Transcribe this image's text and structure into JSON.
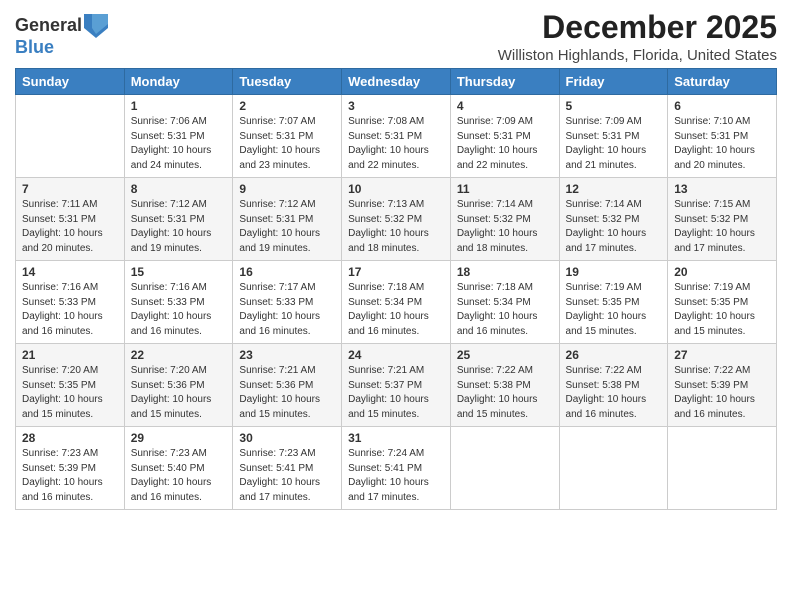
{
  "logo": {
    "general": "General",
    "blue": "Blue"
  },
  "title": "December 2025",
  "location": "Williston Highlands, Florida, United States",
  "weekdays": [
    "Sunday",
    "Monday",
    "Tuesday",
    "Wednesday",
    "Thursday",
    "Friday",
    "Saturday"
  ],
  "weeks": [
    [
      {
        "day": "",
        "info": ""
      },
      {
        "day": "1",
        "info": "Sunrise: 7:06 AM\nSunset: 5:31 PM\nDaylight: 10 hours\nand 24 minutes."
      },
      {
        "day": "2",
        "info": "Sunrise: 7:07 AM\nSunset: 5:31 PM\nDaylight: 10 hours\nand 23 minutes."
      },
      {
        "day": "3",
        "info": "Sunrise: 7:08 AM\nSunset: 5:31 PM\nDaylight: 10 hours\nand 22 minutes."
      },
      {
        "day": "4",
        "info": "Sunrise: 7:09 AM\nSunset: 5:31 PM\nDaylight: 10 hours\nand 22 minutes."
      },
      {
        "day": "5",
        "info": "Sunrise: 7:09 AM\nSunset: 5:31 PM\nDaylight: 10 hours\nand 21 minutes."
      },
      {
        "day": "6",
        "info": "Sunrise: 7:10 AM\nSunset: 5:31 PM\nDaylight: 10 hours\nand 20 minutes."
      }
    ],
    [
      {
        "day": "7",
        "info": "Sunrise: 7:11 AM\nSunset: 5:31 PM\nDaylight: 10 hours\nand 20 minutes."
      },
      {
        "day": "8",
        "info": "Sunrise: 7:12 AM\nSunset: 5:31 PM\nDaylight: 10 hours\nand 19 minutes."
      },
      {
        "day": "9",
        "info": "Sunrise: 7:12 AM\nSunset: 5:31 PM\nDaylight: 10 hours\nand 19 minutes."
      },
      {
        "day": "10",
        "info": "Sunrise: 7:13 AM\nSunset: 5:32 PM\nDaylight: 10 hours\nand 18 minutes."
      },
      {
        "day": "11",
        "info": "Sunrise: 7:14 AM\nSunset: 5:32 PM\nDaylight: 10 hours\nand 18 minutes."
      },
      {
        "day": "12",
        "info": "Sunrise: 7:14 AM\nSunset: 5:32 PM\nDaylight: 10 hours\nand 17 minutes."
      },
      {
        "day": "13",
        "info": "Sunrise: 7:15 AM\nSunset: 5:32 PM\nDaylight: 10 hours\nand 17 minutes."
      }
    ],
    [
      {
        "day": "14",
        "info": "Sunrise: 7:16 AM\nSunset: 5:33 PM\nDaylight: 10 hours\nand 16 minutes."
      },
      {
        "day": "15",
        "info": "Sunrise: 7:16 AM\nSunset: 5:33 PM\nDaylight: 10 hours\nand 16 minutes."
      },
      {
        "day": "16",
        "info": "Sunrise: 7:17 AM\nSunset: 5:33 PM\nDaylight: 10 hours\nand 16 minutes."
      },
      {
        "day": "17",
        "info": "Sunrise: 7:18 AM\nSunset: 5:34 PM\nDaylight: 10 hours\nand 16 minutes."
      },
      {
        "day": "18",
        "info": "Sunrise: 7:18 AM\nSunset: 5:34 PM\nDaylight: 10 hours\nand 16 minutes."
      },
      {
        "day": "19",
        "info": "Sunrise: 7:19 AM\nSunset: 5:35 PM\nDaylight: 10 hours\nand 15 minutes."
      },
      {
        "day": "20",
        "info": "Sunrise: 7:19 AM\nSunset: 5:35 PM\nDaylight: 10 hours\nand 15 minutes."
      }
    ],
    [
      {
        "day": "21",
        "info": "Sunrise: 7:20 AM\nSunset: 5:35 PM\nDaylight: 10 hours\nand 15 minutes."
      },
      {
        "day": "22",
        "info": "Sunrise: 7:20 AM\nSunset: 5:36 PM\nDaylight: 10 hours\nand 15 minutes."
      },
      {
        "day": "23",
        "info": "Sunrise: 7:21 AM\nSunset: 5:36 PM\nDaylight: 10 hours\nand 15 minutes."
      },
      {
        "day": "24",
        "info": "Sunrise: 7:21 AM\nSunset: 5:37 PM\nDaylight: 10 hours\nand 15 minutes."
      },
      {
        "day": "25",
        "info": "Sunrise: 7:22 AM\nSunset: 5:38 PM\nDaylight: 10 hours\nand 15 minutes."
      },
      {
        "day": "26",
        "info": "Sunrise: 7:22 AM\nSunset: 5:38 PM\nDaylight: 10 hours\nand 16 minutes."
      },
      {
        "day": "27",
        "info": "Sunrise: 7:22 AM\nSunset: 5:39 PM\nDaylight: 10 hours\nand 16 minutes."
      }
    ],
    [
      {
        "day": "28",
        "info": "Sunrise: 7:23 AM\nSunset: 5:39 PM\nDaylight: 10 hours\nand 16 minutes."
      },
      {
        "day": "29",
        "info": "Sunrise: 7:23 AM\nSunset: 5:40 PM\nDaylight: 10 hours\nand 16 minutes."
      },
      {
        "day": "30",
        "info": "Sunrise: 7:23 AM\nSunset: 5:41 PM\nDaylight: 10 hours\nand 17 minutes."
      },
      {
        "day": "31",
        "info": "Sunrise: 7:24 AM\nSunset: 5:41 PM\nDaylight: 10 hours\nand 17 minutes."
      },
      {
        "day": "",
        "info": ""
      },
      {
        "day": "",
        "info": ""
      },
      {
        "day": "",
        "info": ""
      }
    ]
  ]
}
